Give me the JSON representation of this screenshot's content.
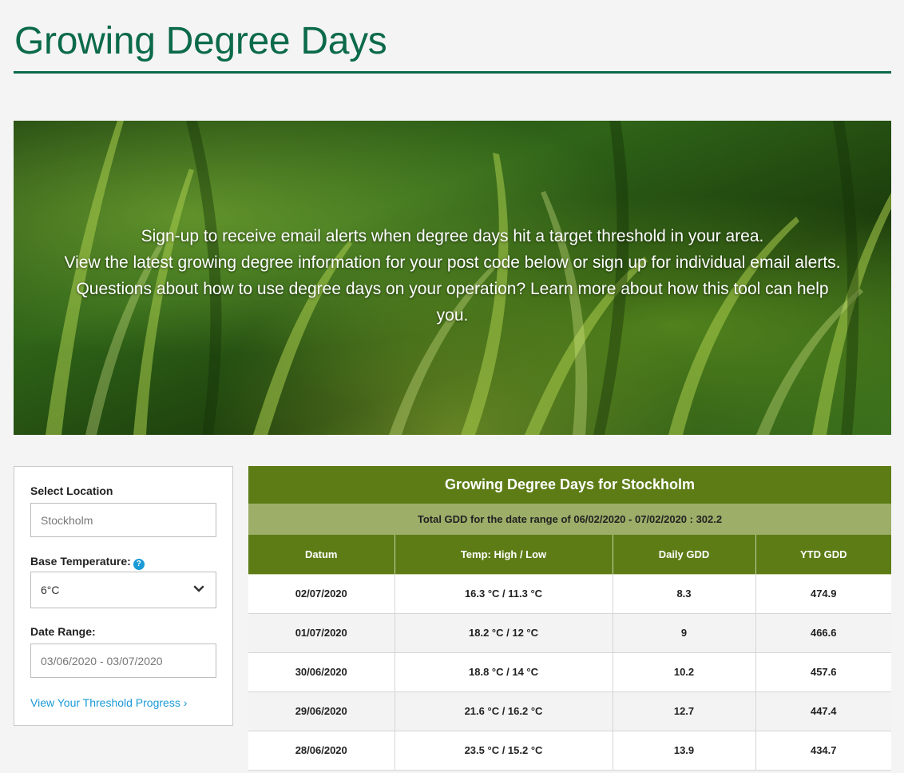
{
  "page": {
    "title": "Growing Degree Days"
  },
  "hero": {
    "line1": "Sign-up to receive email alerts when degree days hit a target threshold in your area.",
    "line2": "View the latest growing degree information for your post code below or sign up for individual email alerts. Questions about how to use degree days on your operation? Learn more about how this tool can help you."
  },
  "sidebar": {
    "location_label": "Select Location",
    "location_value": "Stockholm",
    "base_temp_label": "Base Temperature:",
    "base_temp_help": "?",
    "base_temp_value": "6°C",
    "date_range_label": "Date Range:",
    "date_range_value": "03/06/2020 - 03/07/2020",
    "threshold_link": "View Your Threshold Progress ›"
  },
  "gdd": {
    "title": "Growing Degree Days for Stockholm",
    "total": "Total GDD for the date range of 06/02/2020 - 07/02/2020 : 302.2",
    "columns": [
      "Datum",
      "Temp: High / Low",
      "Daily GDD",
      "YTD GDD"
    ],
    "rows": [
      [
        "02/07/2020",
        "16.3 °C / 11.3 °C",
        "8.3",
        "474.9"
      ],
      [
        "01/07/2020",
        "18.2 °C / 12 °C",
        "9",
        "466.6"
      ],
      [
        "30/06/2020",
        "18.8 °C / 14 °C",
        "10.2",
        "457.6"
      ],
      [
        "29/06/2020",
        "21.6 °C / 16.2 °C",
        "12.7",
        "447.4"
      ],
      [
        "28/06/2020",
        "23.5 °C / 15.2 °C",
        "13.9",
        "434.7"
      ]
    ]
  },
  "colors": {
    "brand_green": "#0b6a4a",
    "table_header": "#5d7c16",
    "total_bar": "#9cae68",
    "link": "#1a9ad6"
  }
}
